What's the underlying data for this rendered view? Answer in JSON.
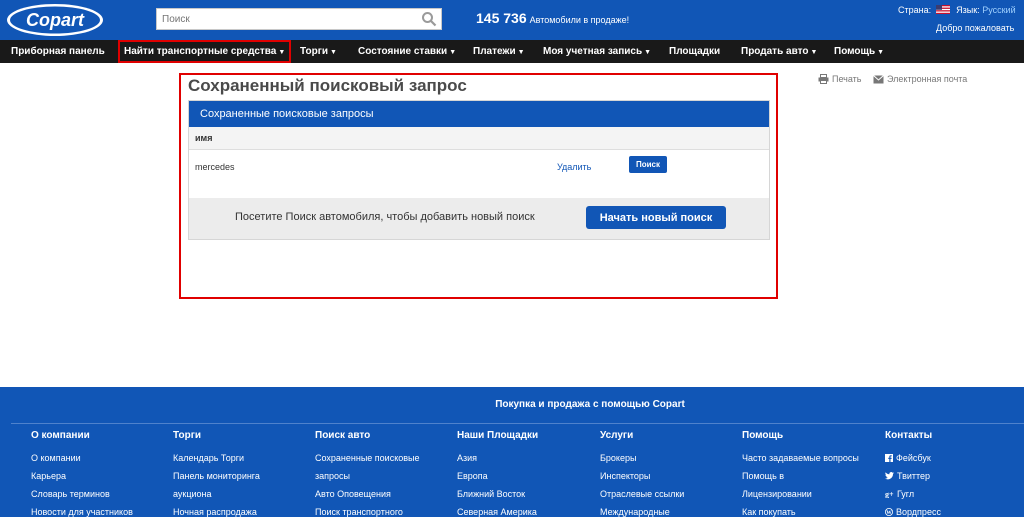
{
  "header": {
    "logo_text": "Copart",
    "search_placeholder": "Поиск",
    "vehicle_count": "145 736",
    "vehicle_count_label": "Автомобили в продаже!",
    "country_label": "Страна:",
    "language_label": "Язык:",
    "language_value": "Русский",
    "welcome": "Добро пожаловать"
  },
  "nav": {
    "items": [
      {
        "label": "Приборная панель",
        "caret": ""
      },
      {
        "label": "Найти транспортные средства",
        "caret": "▼"
      },
      {
        "label": "Торги",
        "caret": "▼"
      },
      {
        "label": "Состояние ставки",
        "caret": "▼"
      },
      {
        "label": "Платежи",
        "caret": "▼"
      },
      {
        "label": "Моя учетная запись",
        "caret": "▼"
      },
      {
        "label": "Площадки",
        "caret": ""
      },
      {
        "label": "Продать авто",
        "caret": "▼"
      },
      {
        "label": "Помощь",
        "caret": "▼"
      }
    ]
  },
  "page": {
    "title": "Сохраненный поисковый запрос",
    "print_label": "Печать",
    "email_label": "Электронная почта"
  },
  "panel": {
    "heading": "Сохраненные поисковые запросы",
    "column_name": "имя",
    "rows": [
      {
        "name": "mercedes",
        "delete_label": "Удалить",
        "search_label": "Поиск"
      }
    ],
    "footer_message": "Посетите Поиск автомобиля, чтобы добавить новый поиск",
    "new_search_label": "Начать новый поиск"
  },
  "footer": {
    "title": "Покупка и продажа с помощью Copart",
    "columns": [
      {
        "heading": "О компании",
        "links": [
          "О компании",
          "Карьера",
          "Словарь терминов",
          "Новости для участников"
        ]
      },
      {
        "heading": "Торги",
        "links": [
          "Календарь Торги",
          "Панель мониторинга",
          "аукциона",
          "Ночная распродажа"
        ]
      },
      {
        "heading": "Поиск авто",
        "links": [
          "Сохраненные поисковые",
          "запросы",
          "Авто Оповещения",
          "Поиск транспортного"
        ]
      },
      {
        "heading": "Наши Площадки",
        "links": [
          "Азия",
          "Европа",
          "Ближний Восток",
          "Северная Америка"
        ]
      },
      {
        "heading": "Услуги",
        "links": [
          "Брокеры",
          "Инспекторы",
          "Отраслевые ссылки",
          "Международные"
        ]
      },
      {
        "heading": "Помощь",
        "links": [
          "Часто задаваемые вопросы",
          "Помощь в",
          "Лицензировании",
          "Как покупать"
        ]
      },
      {
        "heading": "Контакты",
        "links": [
          "Фейсбук",
          "Твиттер",
          "Гугл",
          "Вордпресс"
        ]
      }
    ]
  },
  "colors": {
    "brand_blue": "#1156b6",
    "nav_bg": "#191919",
    "highlight_red": "#e00000"
  }
}
